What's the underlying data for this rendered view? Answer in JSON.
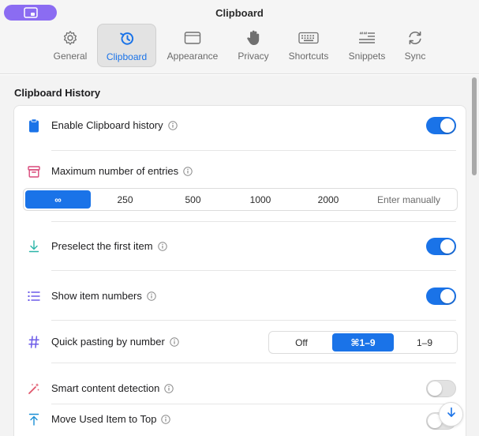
{
  "window": {
    "title": "Clipboard"
  },
  "tabs": [
    {
      "label": "General",
      "icon": "gear-icon"
    },
    {
      "label": "Clipboard",
      "icon": "history-icon",
      "active": true
    },
    {
      "label": "Appearance",
      "icon": "window-icon"
    },
    {
      "label": "Privacy",
      "icon": "hand-icon"
    },
    {
      "label": "Shortcuts",
      "icon": "keyboard-icon"
    },
    {
      "label": "Snippets",
      "icon": "snippets-icon"
    },
    {
      "label": "Sync",
      "icon": "sync-icon"
    }
  ],
  "section": {
    "title": "Clipboard History"
  },
  "settings": {
    "enable_history": {
      "label": "Enable Clipboard history",
      "on": true
    },
    "max_entries": {
      "label": "Maximum number of entries",
      "options": [
        "∞",
        "250",
        "500",
        "1000",
        "2000",
        "Enter manually"
      ],
      "selected": "∞"
    },
    "preselect_first": {
      "label": "Preselect the first item",
      "on": true
    },
    "show_numbers": {
      "label": "Show item numbers",
      "on": true
    },
    "quick_paste": {
      "label": "Quick pasting by number",
      "options": [
        "Off",
        "⌘1–9",
        "1–9"
      ],
      "selected": "⌘1–9"
    },
    "smart_detection": {
      "label": "Smart content detection",
      "on": false
    },
    "move_used_top": {
      "label": "Move Used Item to Top",
      "on": false
    }
  },
  "colors": {
    "accent": "#1a73e8",
    "pill": "#8b6cf2",
    "clipboard_icon": "#1a73e8",
    "entries_icon": "#d9487a",
    "preselect_icon": "#2bb5a8",
    "numbers_icon": "#6d5ce8",
    "quick_paste_icon": "#6d5ce8",
    "smart_icon": "#e0556b",
    "move_top_icon": "#1a8fd6"
  }
}
